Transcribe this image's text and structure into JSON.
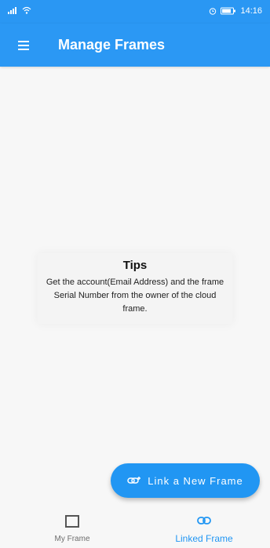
{
  "status_bar": {
    "time": "14:16",
    "battery_label": ""
  },
  "app_bar": {
    "title": "Manage Frames"
  },
  "tips": {
    "title": "Tips",
    "body": "Get the account(Email Address) and the frame Serial Number from the owner of the cloud frame."
  },
  "fab": {
    "label": "Link a New Frame"
  },
  "bottom_nav": {
    "items": [
      {
        "label": "My Frame",
        "icon": "frame-square-icon",
        "selected": false
      },
      {
        "label": "Linked Frame",
        "icon": "link-icon",
        "selected": true
      }
    ]
  },
  "colors": {
    "primary": "#2196f3",
    "app_bar": "#2b98f4",
    "background": "#f7f7f7"
  }
}
